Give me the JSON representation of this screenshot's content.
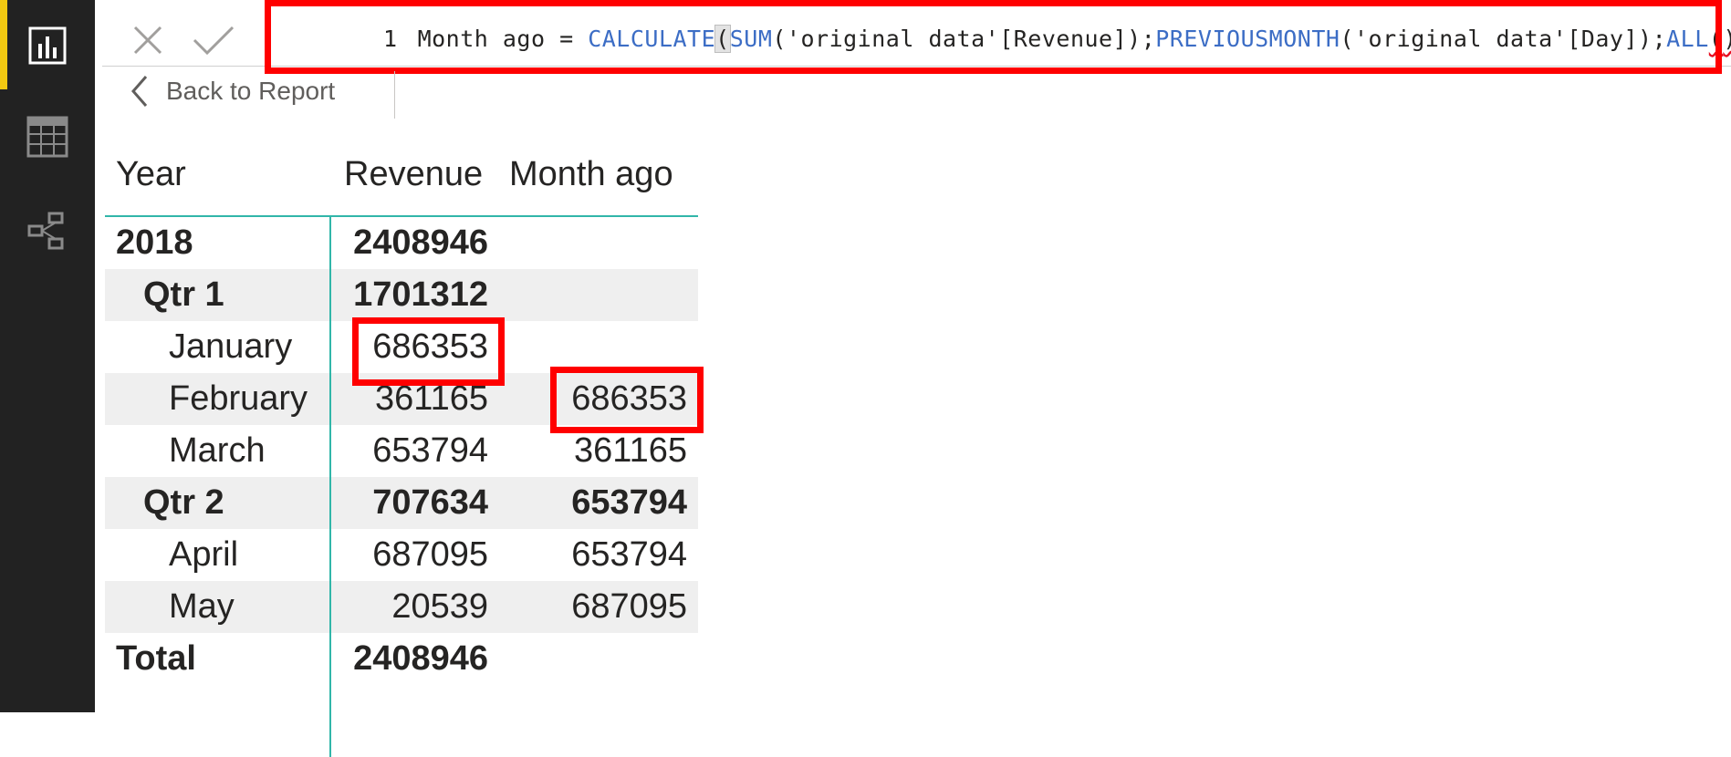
{
  "nav": {
    "items": [
      {
        "name": "report-view",
        "icon": "bar-chart-icon",
        "active": true
      },
      {
        "name": "data-view",
        "icon": "table-grid-icon",
        "active": false
      },
      {
        "name": "model-view",
        "icon": "relationship-icon",
        "active": false
      }
    ],
    "accent_color": "#f2c811"
  },
  "formula_bar": {
    "line_number": "1",
    "measure_name": "Month ago = ",
    "fn_calculate": "CALCULATE",
    "paren_open": "(",
    "fn_sum": "SUM",
    "sum_args": "('original data'[Revenue]);",
    "fn_previousmonth": "PREVIOUSMONTH",
    "pm_args": "('original data'[Day]);",
    "fn_all": "ALL",
    "all_open": "(",
    "all_close": ")",
    "paren_close": ")"
  },
  "back_link": {
    "label": "Back to Report"
  },
  "matrix": {
    "headers": [
      "Year",
      "Revenue",
      "Month ago"
    ],
    "rows": [
      {
        "label": "2018",
        "revenue": "2408946",
        "month_ago": ""
      },
      {
        "label": "Qtr 1",
        "revenue": "1701312",
        "month_ago": ""
      },
      {
        "label": "January",
        "revenue": "686353",
        "month_ago": ""
      },
      {
        "label": "February",
        "revenue": "361165",
        "month_ago": "686353"
      },
      {
        "label": "March",
        "revenue": "653794",
        "month_ago": "361165"
      },
      {
        "label": "Qtr 2",
        "revenue": "707634",
        "month_ago": "653794"
      },
      {
        "label": "April",
        "revenue": "687095",
        "month_ago": "653794"
      },
      {
        "label": "May",
        "revenue": "20539",
        "month_ago": "687095"
      },
      {
        "label": "Total",
        "revenue": "2408946",
        "month_ago": ""
      }
    ]
  },
  "annotation_color": "#ff0000",
  "function_color": "#3c6dc5",
  "matrix_line_color": "#31b6a9"
}
